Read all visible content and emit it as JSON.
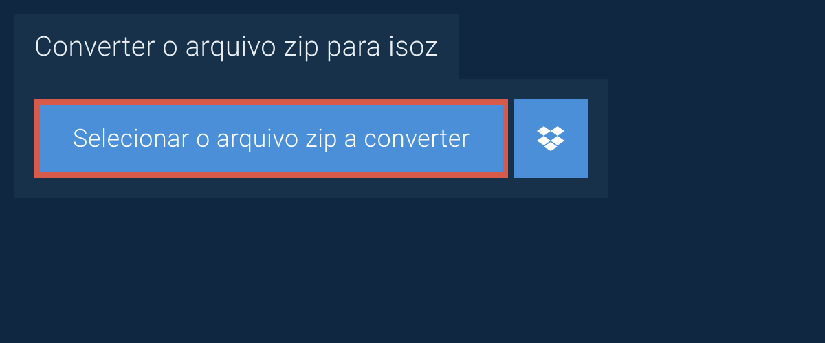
{
  "header": {
    "title": "Converter o arquivo zip para isoz"
  },
  "actions": {
    "select_file_label": "Selecionar o arquivo zip a converter"
  }
}
